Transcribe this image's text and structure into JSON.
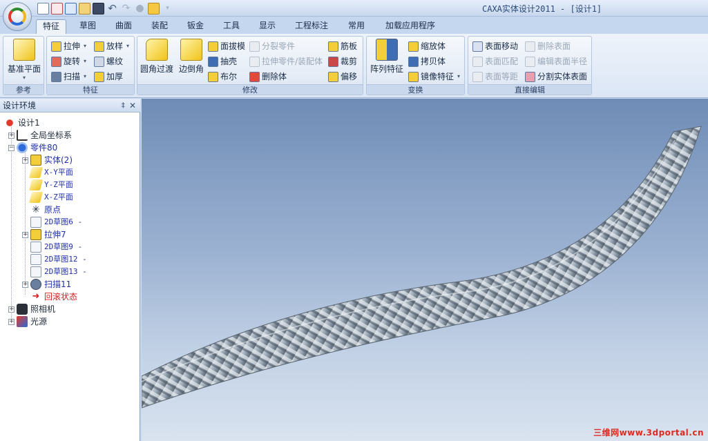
{
  "window": {
    "title": "CAXA实体设计2011 - [设计1]"
  },
  "tabs": [
    "特征",
    "草图",
    "曲面",
    "装配",
    "钣金",
    "工具",
    "显示",
    "工程标注",
    "常用",
    "加载应用程序"
  ],
  "ribbon": {
    "groups": {
      "reference": "参考",
      "feature": "特征",
      "modify": "修改",
      "transform": "变换",
      "direct_edit": "直接编辑"
    },
    "reference": {
      "datum_plane": "基准平面"
    },
    "feature": {
      "extrude": "拉伸",
      "revolve": "旋转",
      "sweep": "扫描",
      "pattern_style": "放样",
      "thread": "螺纹",
      "thicken": "加厚"
    },
    "modify": {
      "fillet": "圆角过渡",
      "chamfer": "边倒角",
      "draft": "面拔模",
      "shell": "抽壳",
      "boolean": "布尔",
      "split_part": "分裂零件",
      "extrude_part": "拉伸零件/装配体",
      "delete_body": "删除体",
      "rib": "筋板",
      "trim": "裁剪",
      "offset": "偏移"
    },
    "transform": {
      "array": "阵列特征",
      "scale": "缩放体",
      "copy": "拷贝体",
      "mirror": "镜像特征"
    },
    "direct_edit": {
      "move_face": "表面移动",
      "match_face": "表面匹配",
      "offset_face": "表面等距",
      "delete_face": "删除表面",
      "edit_radius": "编辑表面半径",
      "split_face": "分割实体表面"
    }
  },
  "panel": {
    "title": "设计环境",
    "pin": "‡",
    "close": "✕",
    "tree": {
      "design": "设计1",
      "global_coords": "全局坐标系",
      "part": "零件80",
      "solid": "实体(2)",
      "xy_plane": "X-Y平面",
      "yz_plane": "Y-Z平面",
      "xz_plane": "X-Z平面",
      "origin": "原点",
      "sketch6": "2D草图6 -",
      "extrude7": "拉伸7",
      "sketch9": "2D草图9 -",
      "sketch12": "2D草图12 -",
      "sketch13": "2D草图13 -",
      "sweep11": "扫描11",
      "rollback": "回滚状态",
      "camera": "照相机",
      "light": "光源"
    }
  },
  "viewport": {
    "watermark": "三维网www.3dportal.cn"
  },
  "colors": {
    "accent": "#f0c419",
    "tab_active": "#eef3fa",
    "rope": "#9aa7b4",
    "rollback": "#d81e1e"
  }
}
